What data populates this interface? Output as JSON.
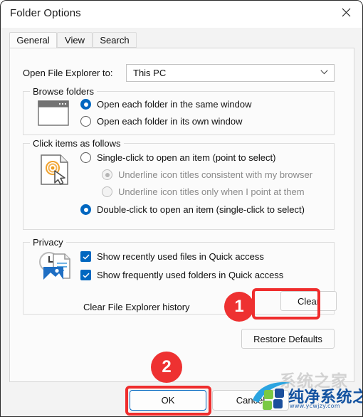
{
  "window": {
    "title": "Folder Options",
    "close_icon": "close-icon"
  },
  "tabs": [
    {
      "label": "General",
      "active": true
    },
    {
      "label": "View",
      "active": false
    },
    {
      "label": "Search",
      "active": false
    }
  ],
  "general": {
    "open_file_explorer": {
      "label": "Open File Explorer to:",
      "value": "This PC",
      "chevron_icon": "chevron-down-icon"
    },
    "browse_folders": {
      "title": "Browse folders",
      "icon": "window-icon",
      "options": [
        {
          "label": "Open each folder in the same window",
          "checked": true
        },
        {
          "label": "Open each folder in its own window",
          "checked": false
        }
      ]
    },
    "click_items": {
      "title": "Click items as follows",
      "icon": "click-page-icon",
      "options": [
        {
          "label": "Single-click to open an item (point to select)",
          "checked": false,
          "disabled": false
        },
        {
          "label": "Underline icon titles consistent with my browser",
          "checked": true,
          "disabled": true
        },
        {
          "label": "Underline icon titles only when I point at them",
          "checked": false,
          "disabled": true
        },
        {
          "label": "Double-click to open an item (single-click to select)",
          "checked": true,
          "disabled": false
        }
      ]
    },
    "privacy": {
      "title": "Privacy",
      "icon": "recent-files-icon",
      "checkboxes": [
        {
          "label": "Show recently used files in Quick access",
          "checked": true
        },
        {
          "label": "Show frequently used folders in Quick access",
          "checked": true
        }
      ],
      "clear_history_label": "Clear File Explorer history",
      "clear_button": "Clear"
    },
    "restore_defaults_button": "Restore Defaults"
  },
  "footer": {
    "ok_button": "OK",
    "cancel_button": "Cancel"
  },
  "annotations": {
    "badge_one": "1",
    "badge_two": "2",
    "highlight_color": "#ee3131"
  },
  "watermark": {
    "ghost_text": "系统之家",
    "brand_text": "纯净系统之家",
    "url_text": "www.ycwjzy.com"
  }
}
